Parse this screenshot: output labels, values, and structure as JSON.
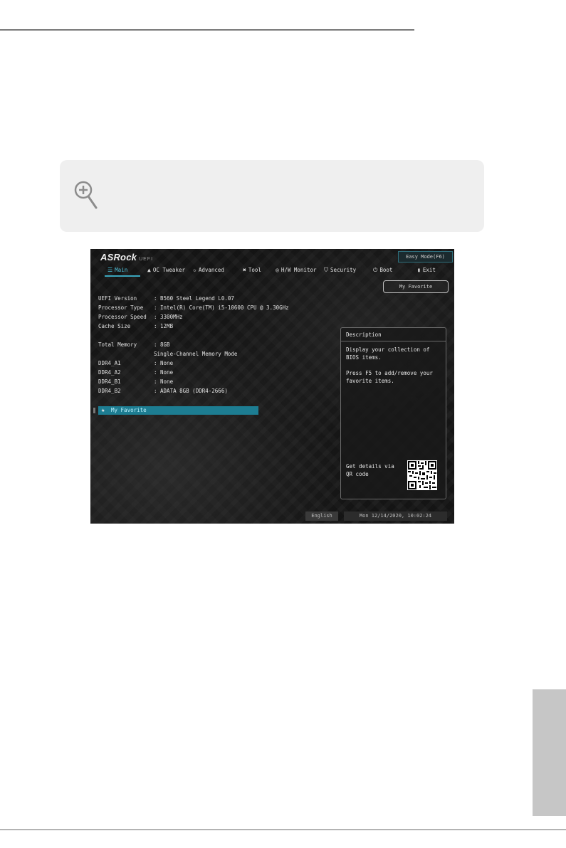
{
  "bios": {
    "logo": "ASRock",
    "logo_sub": "UEFI",
    "easy_mode": "Easy Mode(F6)",
    "tabs": [
      {
        "label": "Main",
        "icon": "list-icon"
      },
      {
        "label": "OC Tweaker",
        "icon": "flame-icon"
      },
      {
        "label": "Advanced",
        "icon": "star-icon"
      },
      {
        "label": "Tool",
        "icon": "tools-icon"
      },
      {
        "label": "H/W Monitor",
        "icon": "monitor-icon"
      },
      {
        "label": "Security",
        "icon": "shield-icon"
      },
      {
        "label": "Boot",
        "icon": "power-icon"
      },
      {
        "label": "Exit",
        "icon": "exit-icon"
      }
    ],
    "favorite_button": "My Favorite",
    "info": [
      {
        "label": "UEFI Version",
        "value": ": B560 Steel Legend L0.07"
      },
      {
        "label": "Processor Type",
        "value": ": Intel(R) Core(TM) i5-10600 CPU @ 3.30GHz"
      },
      {
        "label": "Processor Speed",
        "value": ": 3300MHz"
      },
      {
        "label": "Cache Size",
        "value": ": 12MB"
      },
      {
        "label": "Total Memory",
        "value": ": 8GB"
      },
      {
        "label": "",
        "value": "  Single-Channel Memory Mode"
      },
      {
        "label": "DDR4_A1",
        "value": ": None"
      },
      {
        "label": "DDR4_A2",
        "value": ": None"
      },
      {
        "label": "DDR4_B1",
        "value": ": None"
      },
      {
        "label": "DDR4_B2",
        "value": ": ADATA 8GB (DDR4-2666)"
      }
    ],
    "selected_item": "My Favorite",
    "description": {
      "title": "Description",
      "text": "Display your collection of BIOS items.\n\nPress F5 to add/remove your favorite items.",
      "qr_text": "Get details via QR code"
    },
    "language": "English",
    "datetime": "Mon 12/14/2020, 10:02:24",
    "accent_color": "#1d7d92"
  }
}
